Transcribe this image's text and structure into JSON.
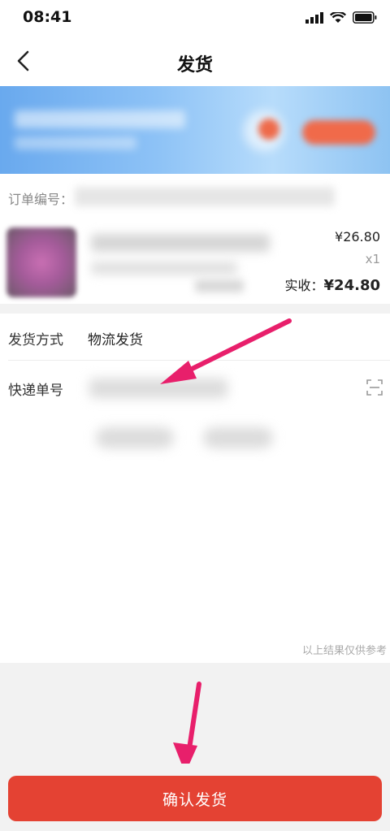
{
  "status_bar": {
    "time": "08:41"
  },
  "nav": {
    "title": "发货"
  },
  "order": {
    "order_no_label": "订单编号：",
    "price": "¥26.80",
    "quantity": "x1",
    "actual_label": "实收：",
    "actual_amount": "¥24.80"
  },
  "shipping": {
    "method_label": "发货方式",
    "method_value": "物流发货",
    "tracking_label": "快递单号"
  },
  "disclaimer": "以上结果仅供参考",
  "footer": {
    "confirm_label": "确认发货"
  },
  "colors": {
    "accent": "#e44233",
    "annotation_arrow": "#e81f6b"
  }
}
